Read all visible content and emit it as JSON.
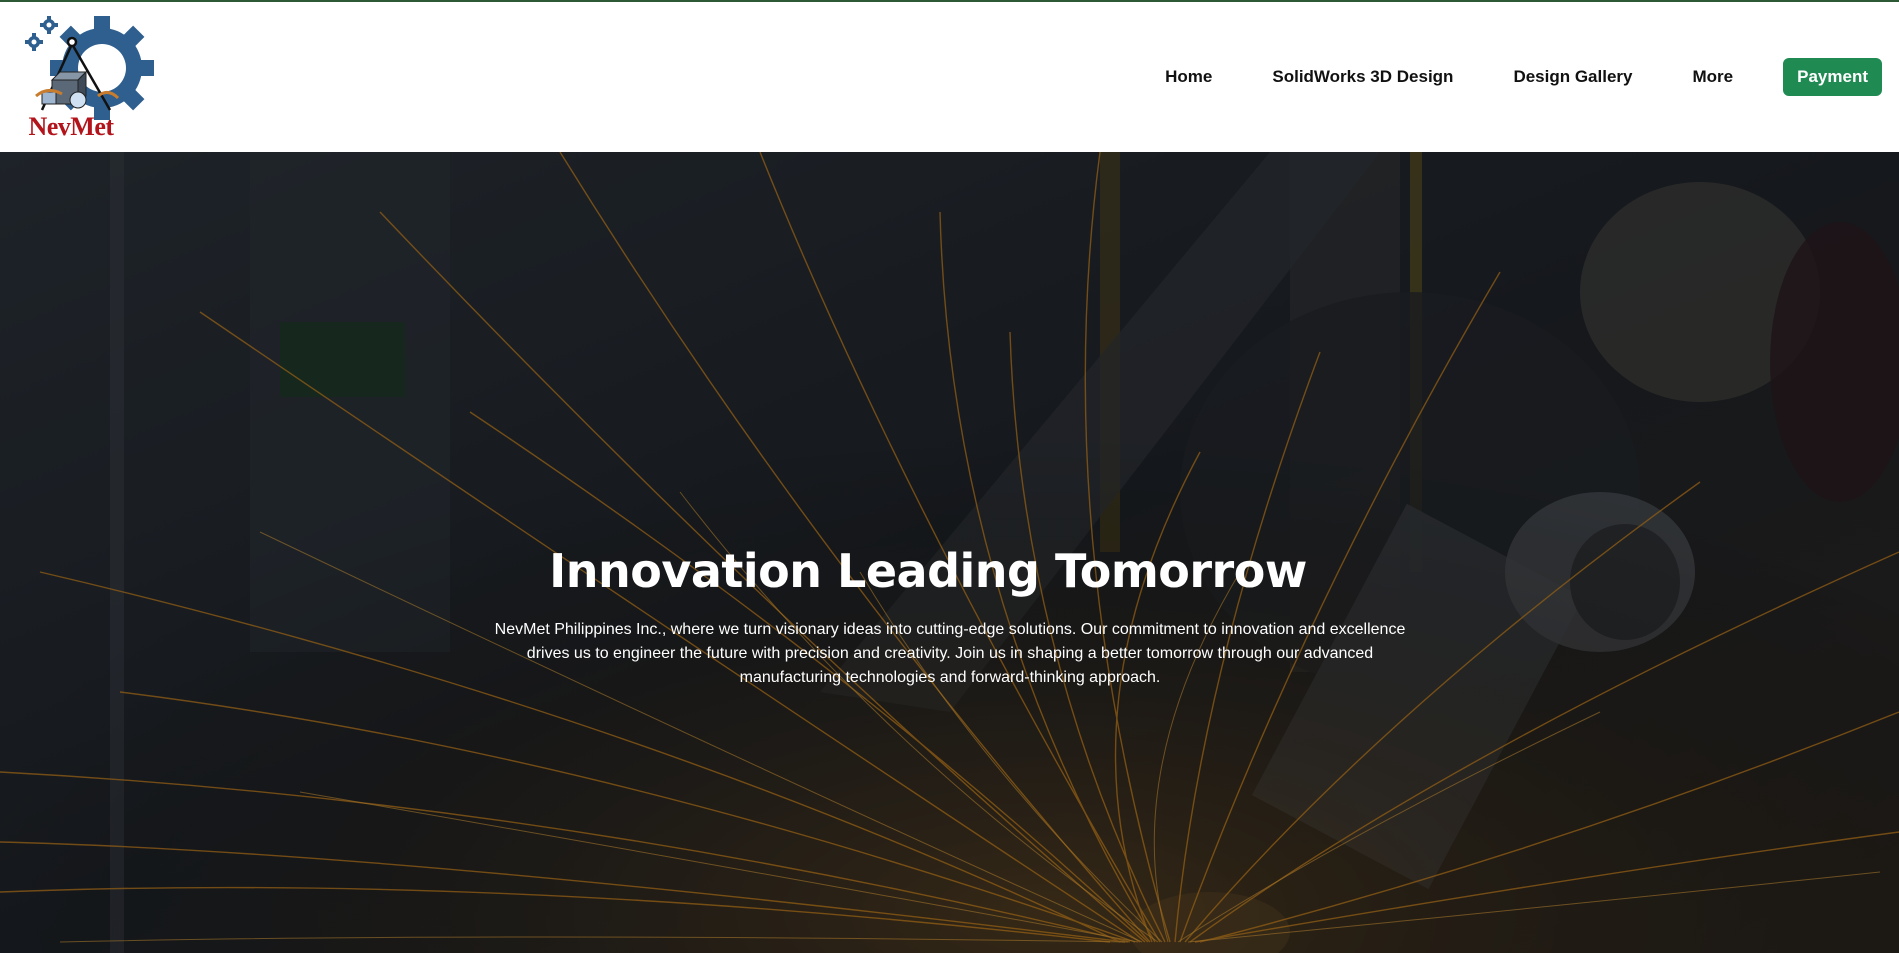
{
  "brand": {
    "logo_text": "NevMet",
    "logo_icon": "gear-compass-logo-icon",
    "colors": {
      "gear": "#2e5f8e",
      "text": "#b3141b",
      "topline": "#2d5a34"
    }
  },
  "nav": {
    "items": [
      {
        "label": "Home"
      },
      {
        "label": "SolidWorks 3D Design"
      },
      {
        "label": "Design Gallery"
      },
      {
        "label": "More"
      }
    ],
    "payment_label": "Payment",
    "payment_color": "#1f8a52"
  },
  "hero": {
    "title": "Innovation Leading Tomorrow",
    "description": "NevMet Philippines Inc., where we turn visionary ideas into cutting-edge solutions. Our commitment to innovation and excellence drives us to engineer the future with precision and creativity. Join us in shaping a better tomorrow through our advanced manufacturing technologies and forward-thinking approach.",
    "background_icon": "welding-sparks-image"
  }
}
